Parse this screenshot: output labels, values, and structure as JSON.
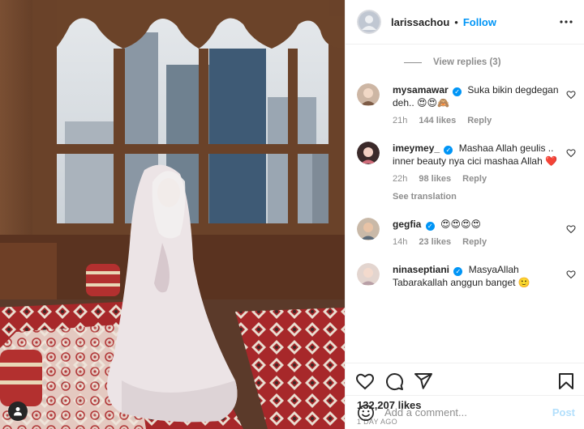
{
  "header": {
    "username": "larissachou",
    "separator": "•",
    "follow_label": "Follow",
    "more_icon": "more-horizontal-icon"
  },
  "comments": {
    "view_replies_label": "View replies (3)",
    "items": [
      {
        "username": "mysamawar",
        "verified": true,
        "text": "Suka bikin degdegan deh.. 😍😍🙈",
        "time": "21h",
        "likes": "144 likes",
        "reply_label": "Reply"
      },
      {
        "username": "imeymey_",
        "verified": true,
        "text": "Mashaa Allah geulis .. inner beauty nya cici mashaa Allah ❤️",
        "time": "22h",
        "likes": "98 likes",
        "reply_label": "Reply",
        "translation_label": "See translation"
      },
      {
        "username": "gegfia",
        "verified": true,
        "text": "😍😍😍😍",
        "time": "14h",
        "likes": "23 likes",
        "reply_label": "Reply"
      },
      {
        "username": "ninaseptiani",
        "verified": true,
        "text": "MasyaAllah Tabarakallah anggun banget 🙂",
        "time": "",
        "likes": "",
        "reply_label": ""
      }
    ]
  },
  "actions": {
    "like_icon": "heart-icon",
    "comment_icon": "comment-icon",
    "share_icon": "share-icon",
    "save_icon": "bookmark-icon"
  },
  "likes_count": "132,207 likes",
  "posted_ago": "1 DAY AGO",
  "add_comment": {
    "placeholder": "Add a comment...",
    "post_label": "Post"
  },
  "colors": {
    "accent": "#0095f6",
    "post_disabled": "#b2dffc",
    "muted": "#8e8e8e",
    "heart_red": "#ed4956"
  }
}
